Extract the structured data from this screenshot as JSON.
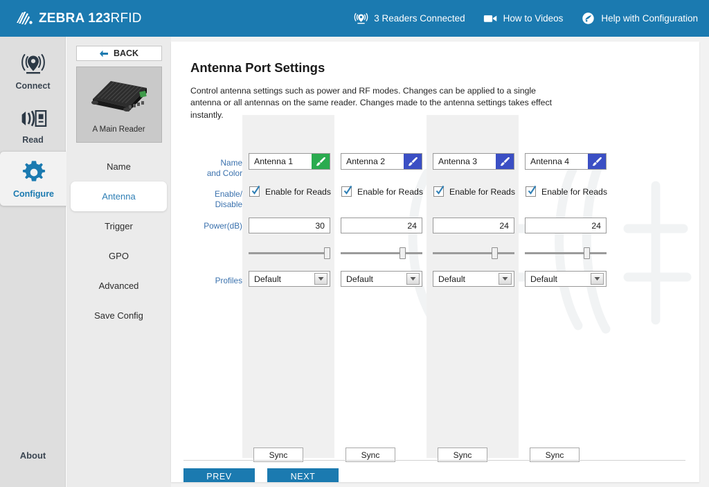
{
  "header": {
    "brand_bold": "ZEBRA ",
    "brand_num": "123",
    "brand_light": "RFID",
    "logo_icon": "zebra-head-icon",
    "items": [
      {
        "label": "3 Readers Connected",
        "icon": "readers-connected-icon"
      },
      {
        "label": "How to Videos",
        "icon": "video-camera-icon"
      },
      {
        "label": "Help with Configuration",
        "icon": "help-circle-icon"
      }
    ],
    "bg_color": "#1b7ab0"
  },
  "rail": {
    "items": [
      {
        "label": "Connect",
        "icon": "connect-antenna-icon",
        "active": false
      },
      {
        "label": "Read",
        "icon": "read-tag-icon",
        "active": false
      },
      {
        "label": "Configure",
        "icon": "gear-icon",
        "active": true
      }
    ],
    "about_label": "About",
    "active_color": "#1b7ab0"
  },
  "subnav": {
    "back_label": "BACK",
    "back_icon": "arrow-left-icon",
    "reader_name": "A Main Reader",
    "reader_icon": "rfid-reader-device-image",
    "items": [
      {
        "label": "Name",
        "active": false
      },
      {
        "label": "Antenna",
        "active": true
      },
      {
        "label": "Trigger",
        "active": false
      },
      {
        "label": "GPO",
        "active": false
      },
      {
        "label": "Advanced",
        "active": false
      },
      {
        "label": "Save Config",
        "active": false
      }
    ]
  },
  "main": {
    "title": "Antenna Port Settings",
    "description": "Control antenna settings such as power and RF modes. Changes can be applied to a single antenna or all antennas on the same reader. Changes made to the antenna settings takes effect instantly.",
    "row_labels": {
      "name_color": "Name\nand Color",
      "name_color_l1": "Name",
      "name_color_l2": "and Color",
      "enable_disable_l1": "Enable/",
      "enable_disable_l2": "Disable",
      "power": "Power(dB)",
      "profiles": "Profiles"
    },
    "enable_label": "Enable for Reads",
    "sync_label": "Sync",
    "columns": [
      {
        "name": "Antenna 1",
        "color": "#2aab4f",
        "color_icon": "paint-brush-icon",
        "enabled": true,
        "power": "30",
        "slider_pct": 100,
        "profile": "Default",
        "shaded": true
      },
      {
        "name": "Antenna 2",
        "color": "#3b4fc4",
        "color_icon": "paint-brush-icon",
        "enabled": true,
        "power": "24",
        "slider_pct": 78,
        "profile": "Default",
        "shaded": false
      },
      {
        "name": "Antenna 3",
        "color": "#3b4fc4",
        "color_icon": "paint-brush-icon",
        "enabled": true,
        "power": "24",
        "slider_pct": 78,
        "profile": "Default",
        "shaded": true
      },
      {
        "name": "Antenna 4",
        "color": "#3b4fc4",
        "color_icon": "paint-brush-icon",
        "enabled": true,
        "power": "24",
        "slider_pct": 78,
        "profile": "Default",
        "shaded": false
      }
    ]
  },
  "footer": {
    "prev_label": "PREV",
    "next_label": "NEXT"
  }
}
